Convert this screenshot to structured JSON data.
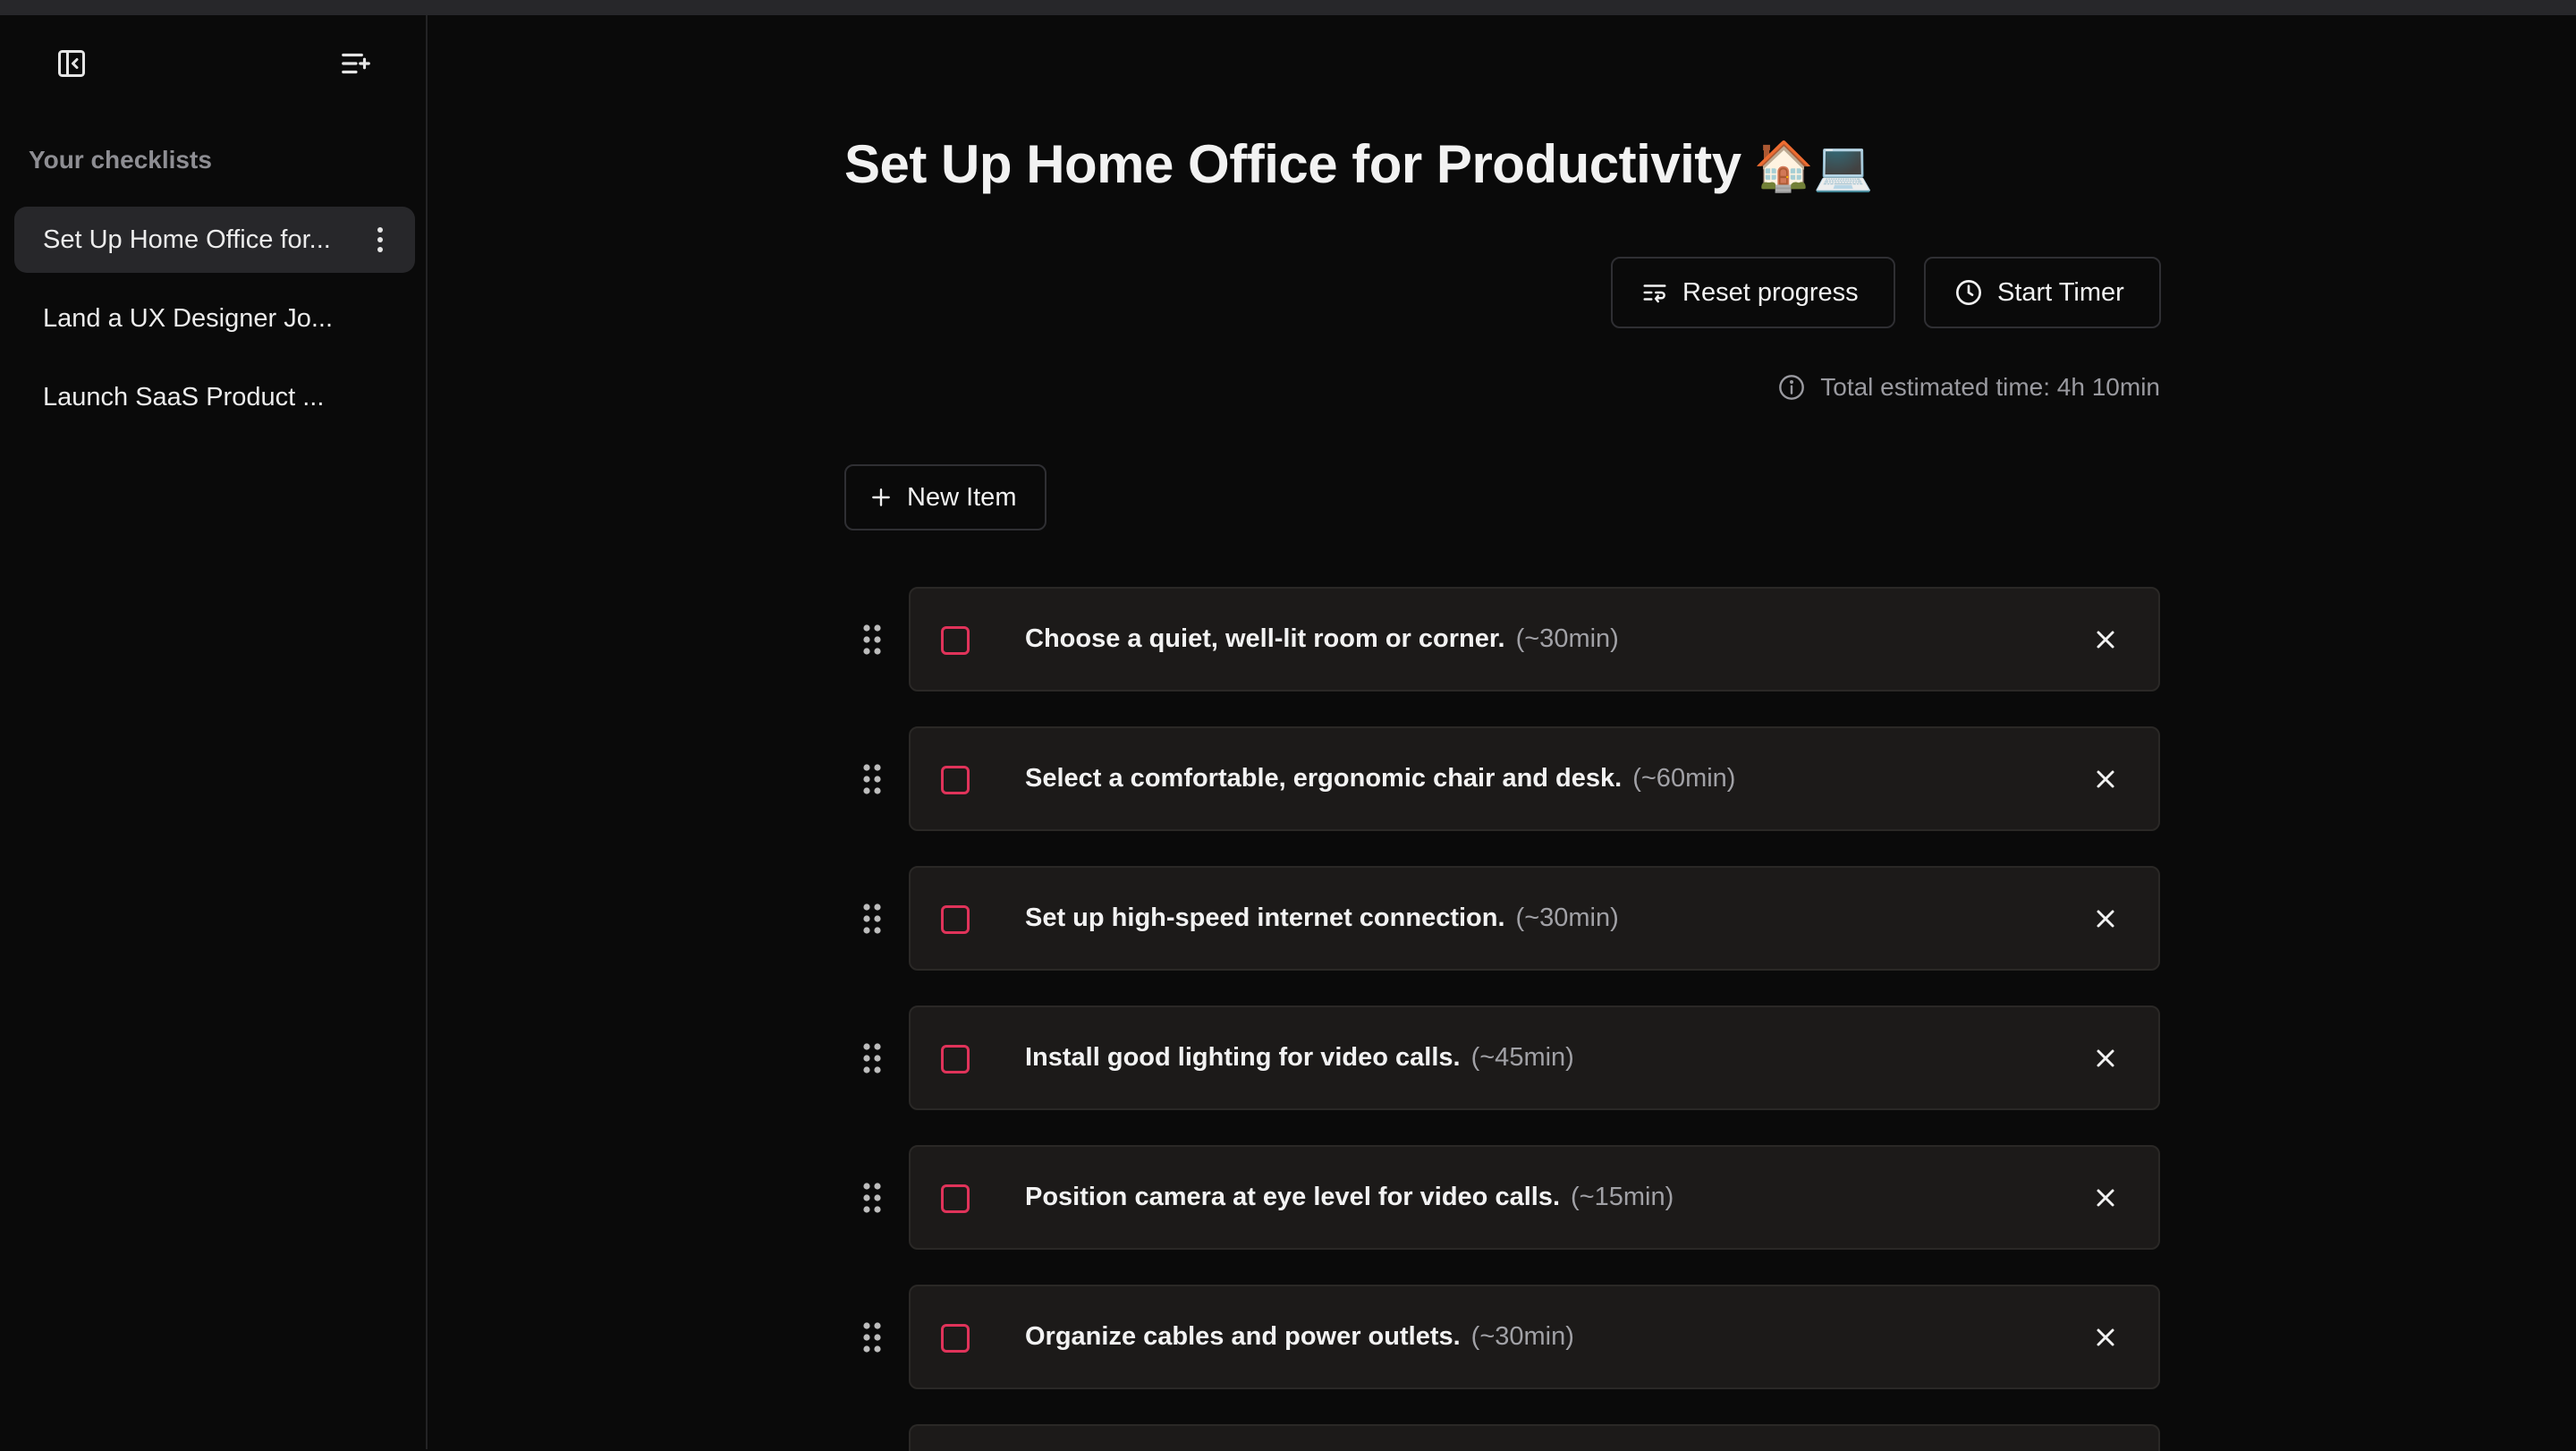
{
  "sidebar": {
    "collapse_icon": "sidebar-collapse-icon",
    "new_list_icon": "list-add-icon",
    "heading": "Your checklists",
    "items": [
      {
        "label": "Set Up Home Office for...",
        "active": true
      },
      {
        "label": "Land a UX Designer Jo...",
        "active": false
      },
      {
        "label": "Launch SaaS Product ...",
        "active": false
      }
    ]
  },
  "main": {
    "title": "Set Up Home Office for Productivity",
    "title_emoji": "🏠💻",
    "reset_label": "Reset progress",
    "timer_label": "Start Timer",
    "total_time": "Total estimated time: 4h 10min",
    "new_item_label": "New Item",
    "items": [
      {
        "title": "Choose a quiet, well-lit room or corner.",
        "time": "(~30min)",
        "checked": false
      },
      {
        "title": "Select a comfortable, ergonomic chair and desk.",
        "time": "(~60min)",
        "checked": false
      },
      {
        "title": "Set up high-speed internet connection.",
        "time": "(~30min)",
        "checked": false
      },
      {
        "title": "Install good lighting for video calls.",
        "time": "(~45min)",
        "checked": false
      },
      {
        "title": "Position camera at eye level for video calls.",
        "time": "(~15min)",
        "checked": false
      },
      {
        "title": "Organize cables and power outlets.",
        "time": "(~30min)",
        "checked": false
      }
    ]
  },
  "colors": {
    "background": "#0a0a0a",
    "card": "#1c1a19",
    "checkbox_border": "#e0335a",
    "muted_text": "#9a9aa0"
  }
}
